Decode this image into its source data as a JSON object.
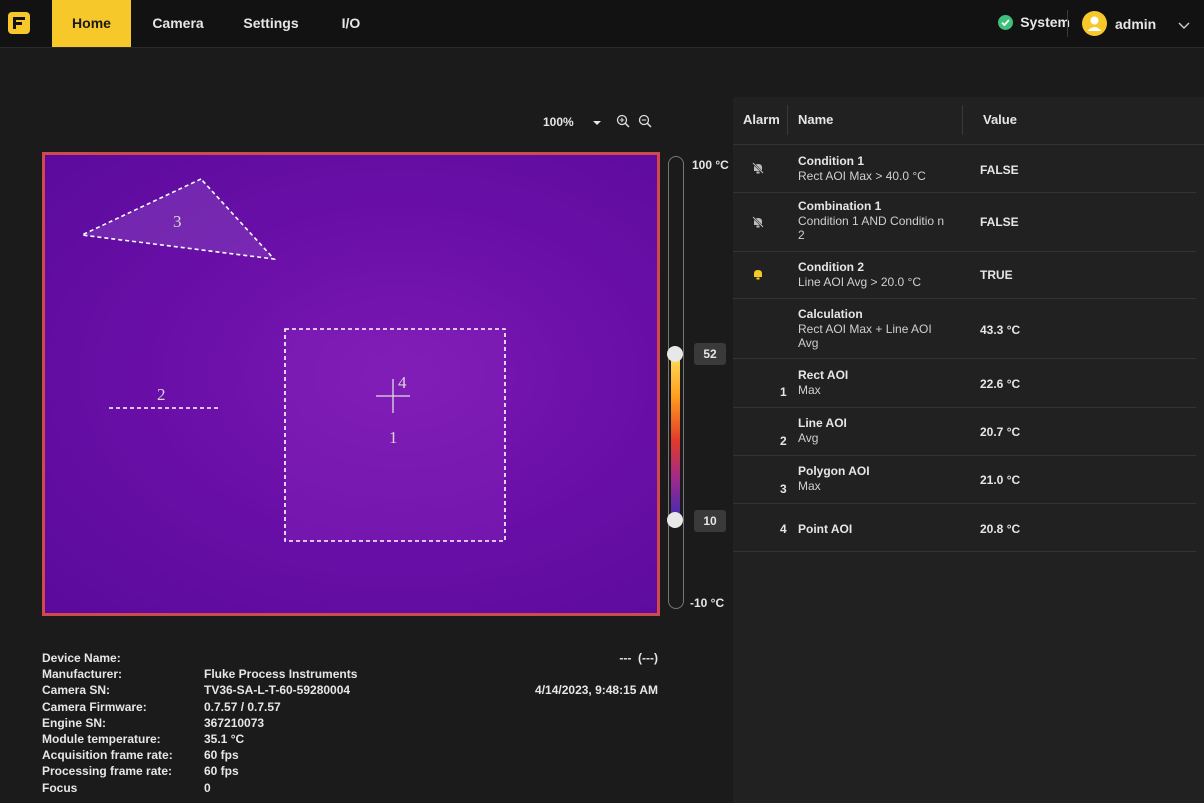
{
  "nav": {
    "tabs": [
      {
        "label": "Home"
      },
      {
        "label": "Camera"
      },
      {
        "label": "Settings"
      },
      {
        "label": "I/O"
      }
    ],
    "status_label": "System",
    "user": "admin"
  },
  "image_view": {
    "zoom": "100%",
    "aoi_labels": [
      "1",
      "2",
      "3",
      "4"
    ]
  },
  "scale": {
    "max_label": "100 °C",
    "min_label": "-10 °C",
    "upper_value": "52",
    "lower_value": "10"
  },
  "device_info": [
    {
      "key": "Device Name:",
      "value": ""
    },
    {
      "key": "Manufacturer:",
      "value": "Fluke Process Instruments"
    },
    {
      "key": "Camera SN:",
      "value": "TV36-SA-L-T-60-59280004"
    },
    {
      "key": "Camera Firmware:",
      "value": "0.7.57 / 0.7.57"
    },
    {
      "key": "Engine SN:",
      "value": "367210073"
    },
    {
      "key": "Module temperature:",
      "value": "35.1 °C"
    },
    {
      "key": "Acquisition frame rate:",
      "value": "60 fps"
    },
    {
      "key": "Processing frame rate:",
      "value": "60 fps"
    },
    {
      "key": "Focus",
      "value": "0"
    }
  ],
  "status_readout": "---  (---)",
  "timestamp": "4/14/2023, 9:48:15 AM",
  "table": {
    "headers": {
      "alarm": "Alarm",
      "name": "Name",
      "value": "Value"
    },
    "rows": [
      {
        "alarm_icon": "bell-off-icon",
        "num": "",
        "name": "Condition 1",
        "detail": "Rect AOI Max > 40.0 °C",
        "value": "FALSE"
      },
      {
        "alarm_icon": "bell-off-icon",
        "num": "",
        "name": "Combination 1",
        "detail": "Condition 1 AND Conditio n 2",
        "value": "FALSE"
      },
      {
        "alarm_icon": "bell-active-icon",
        "num": "",
        "name": "Condition 2",
        "detail": "Line AOI Avg > 20.0 °C",
        "value": "TRUE"
      },
      {
        "alarm_icon": "",
        "num": "",
        "name": "Calculation",
        "detail": "Rect AOI Max + Line AOI Avg",
        "value": "43.3 °C"
      },
      {
        "alarm_icon": "",
        "num": "1",
        "name": "Rect AOI",
        "detail": "Max",
        "value": "22.6 °C"
      },
      {
        "alarm_icon": "",
        "num": "2",
        "name": "Line AOI",
        "detail": "Avg",
        "value": "20.7 °C"
      },
      {
        "alarm_icon": "",
        "num": "3",
        "name": "Polygon AOI",
        "detail": "Max",
        "value": "21.0 °C"
      },
      {
        "alarm_icon": "",
        "num": "4",
        "name": "Point AOI",
        "detail": "",
        "value": "20.8 °C"
      }
    ]
  },
  "colors": {
    "accent": "#f7c82a",
    "frame_border": "#d04a4a",
    "status_ok": "#3ec07a"
  }
}
